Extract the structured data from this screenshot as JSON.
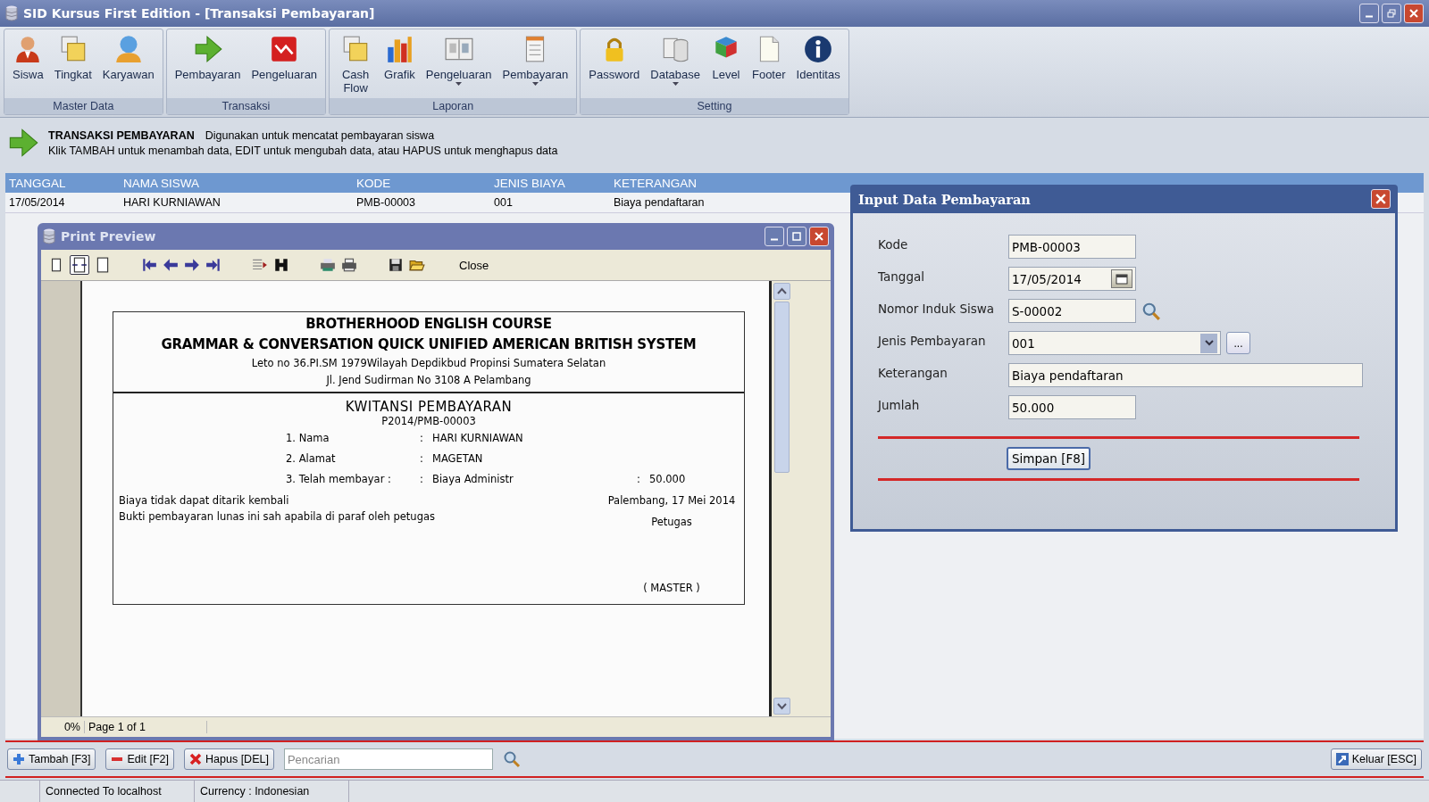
{
  "window": {
    "title": "SID Kursus First Edition - [Transaksi Pembayaran]"
  },
  "ribbon": {
    "groups": [
      {
        "label": "Master Data",
        "items": [
          {
            "label": "Siswa",
            "dropdown": false
          },
          {
            "label": "Tingkat",
            "dropdown": false
          },
          {
            "label": "Karyawan",
            "dropdown": false
          }
        ]
      },
      {
        "label": "Transaksi",
        "items": [
          {
            "label": "Pembayaran",
            "dropdown": false
          },
          {
            "label": "Pengeluaran",
            "dropdown": false
          }
        ]
      },
      {
        "label": "Laporan",
        "items": [
          {
            "label": "Cash Flow",
            "dropdown": false
          },
          {
            "label": "Grafik",
            "dropdown": false
          },
          {
            "label": "Pengeluaran",
            "dropdown": true
          },
          {
            "label": "Pembayaran",
            "dropdown": true
          }
        ]
      },
      {
        "label": "Setting",
        "items": [
          {
            "label": "Password",
            "dropdown": false
          },
          {
            "label": "Database",
            "dropdown": true
          },
          {
            "label": "Level",
            "dropdown": false
          },
          {
            "label": "Footer",
            "dropdown": false
          },
          {
            "label": "Identitas",
            "dropdown": false
          }
        ]
      }
    ]
  },
  "info": {
    "title": "TRANSAKSI PEMBAYARAN",
    "description": "Digunakan untuk mencatat pembayaran siswa",
    "hint": "Klik TAMBAH untuk menambah data, EDIT untuk mengubah data, atau HAPUS untuk menghapus data"
  },
  "table": {
    "columns": [
      "TANGGAL",
      "NAMA SISWA",
      "KODE",
      "JENIS BIAYA",
      "KETERANGAN"
    ],
    "rows": [
      [
        "17/05/2014",
        "HARI KURNIAWAN",
        "PMB-00003",
        "001",
        "Biaya pendaftaran"
      ]
    ]
  },
  "print_preview": {
    "title": "Print Preview",
    "close_label": "Close",
    "document": {
      "header": [
        "BROTHERHOOD ENGLISH COURSE",
        "GRAMMAR & CONVERSATION QUICK UNIFIED AMERICAN BRITISH SYSTEM",
        "Leto no 36.PI.SM 1979Wilayah Depdikbud Propinsi Sumatera Selatan",
        "Jl. Jend Sudirman No 3108 A Pelambang"
      ],
      "receipt_title": "KWITANSI PEMBAYARAN",
      "receipt_number": "P2014/PMB-00003",
      "rows": [
        {
          "label": "1. Nama",
          "sep": ":",
          "value": "HARI KURNIAWAN"
        },
        {
          "label": "2. Alamat",
          "sep": ":",
          "value": "MAGETAN"
        },
        {
          "label": "3. Telah membayar :",
          "sep": ":",
          "value": "Biaya Administr",
          "amount_sep": ":",
          "amount": "50.000"
        }
      ],
      "notes": [
        "Biaya tidak dapat ditarik kembali",
        "Bukti pembayaran lunas ini sah apabila di paraf oleh petugas"
      ],
      "place_date": "Palembang, 17 Mei 2014",
      "signer_title": "Petugas",
      "signer_name": "( MASTER )"
    },
    "status": {
      "zoom": "0%",
      "page": "Page 1 of 1"
    }
  },
  "dialog": {
    "title": "Input Data Pembayaran",
    "fields": [
      {
        "label": "Kode",
        "value": "PMB-00003",
        "kind": "text"
      },
      {
        "label": "Tanggal",
        "value": "17/05/2014",
        "kind": "date"
      },
      {
        "label": "Nomor Induk Siswa",
        "value": "S-00002",
        "kind": "lookup"
      },
      {
        "label": "Jenis Pembayaran",
        "value": "001",
        "kind": "combo",
        "more_label": "..."
      },
      {
        "label": "Keterangan",
        "value": "Biaya pendaftaran",
        "kind": "wide"
      },
      {
        "label": "Jumlah",
        "value": "50.000",
        "kind": "text"
      }
    ],
    "save_label": "Simpan [F8]"
  },
  "actions": {
    "add": "Tambah [F3]",
    "edit": "Edit [F2]",
    "delete": "Hapus [DEL]",
    "search_placeholder": "Pencarian",
    "exit": "Keluar [ESC]"
  },
  "status_bar": [
    "Connected To localhost",
    "Currency : Indonesian"
  ]
}
